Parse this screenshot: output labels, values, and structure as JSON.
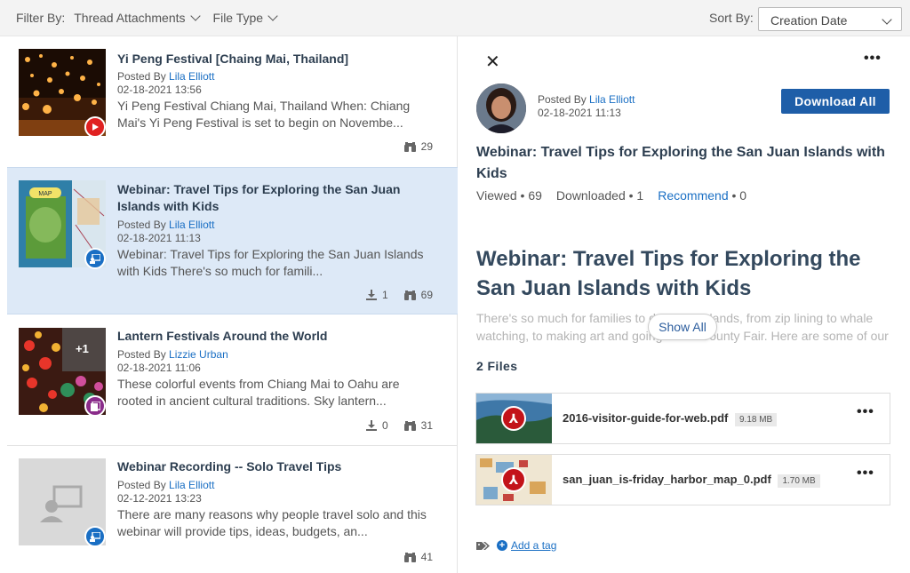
{
  "filter": {
    "label": "Filter By:",
    "thread": "Thread Attachments",
    "filetype": "File Type"
  },
  "sort": {
    "label": "Sort By:",
    "value": "Creation Date"
  },
  "items": [
    {
      "title": "Yi Peng Festival [Chaing Mai, Thailand]",
      "posted_by": "Posted By",
      "author": "Lila Elliott",
      "date": "02-18-2021 13:56",
      "desc": "Yi Peng Festival Chiang Mai, Thailand When: Chiang Mai's Yi Peng Festival is set to begin on Novembe...",
      "views": "29",
      "badge_icon": "youtube-icon"
    },
    {
      "title": "Webinar: Travel Tips for Exploring the San Juan Islands with Kids",
      "posted_by": "Posted By",
      "author": "Lila Elliott",
      "date": "02-18-2021 11:13",
      "desc": "Webinar: Travel Tips for Exploring the San Juan Islands with Kids There's so much for famili...",
      "downloads": "1",
      "views": "69",
      "badge_icon": "webinar-icon"
    },
    {
      "title": "Lantern Festivals Around the World",
      "posted_by": "Posted By",
      "author": "Lizzie Urban",
      "date": "02-18-2021 11:06",
      "desc": "These colorful events from Chiang Mai to Oahu are rooted in ancient cultural traditions. Sky lantern...",
      "downloads": "0",
      "views": "31",
      "overlay": "+1",
      "badge_icon": "gallery-icon"
    },
    {
      "title": "Webinar Recording -- Solo Travel Tips",
      "posted_by": "Posted By",
      "author": "Lila Elliott",
      "date": "02-12-2021 13:23",
      "desc": "There are many reasons why people travel solo and this webinar will provide tips, ideas, budgets, an...",
      "views": "41",
      "badge_icon": "webinar-icon"
    }
  ],
  "detail": {
    "posted_by": "Posted By",
    "author": "Lila Elliott",
    "date": "02-18-2021 11:13",
    "download_all": "Download All",
    "title": "Webinar: Travel Tips for Exploring the San Juan Islands with Kids",
    "viewed": "Viewed • 69",
    "downloaded": "Downloaded • 1",
    "recommend": "Recommend",
    "recommend_count": "• 0",
    "big_title": "Webinar: Travel Tips for Exploring the San Juan Islands with Kids",
    "body_line1": "There's so much for families to do in the Islands, from zip lining to whale",
    "body_line2": "watching, to making art and going to the County Fair. Here are some of our",
    "show_all": "Show All",
    "files_header": "2 Files",
    "files": [
      {
        "name": "2016-visitor-guide-for-web.pdf",
        "size": "9.18 MB"
      },
      {
        "name": "san_juan_is-friday_harbor_map_0.pdf",
        "size": "1.70 MB"
      }
    ],
    "add_tag": "Add a tag"
  },
  "colors": {
    "accent": "#1e5ea8",
    "selected_bg": "#dde9f7",
    "link": "#1a6fc4",
    "pdf": "#c3131a"
  }
}
